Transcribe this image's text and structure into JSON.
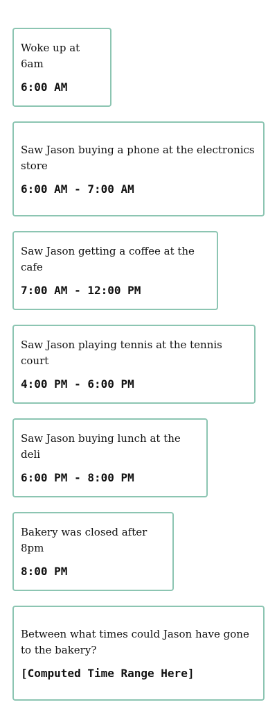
{
  "cards": [
    {
      "text": "Woke up at 6am",
      "time": "6:00 AM"
    },
    {
      "text": "Saw Jason buying a phone at the electronics store",
      "time": "6:00 AM - 7:00 AM"
    },
    {
      "text": "Saw Jason getting a coffee at the cafe",
      "time": "7:00 AM - 12:00 PM"
    },
    {
      "text": "Saw Jason playing tennis at the tennis court",
      "time": "4:00 PM - 6:00 PM"
    },
    {
      "text": "Saw Jason buying lunch at the deli",
      "time": "6:00 PM - 8:00 PM"
    },
    {
      "text": "Bakery was closed after 8pm",
      "time": "8:00 PM"
    },
    {
      "text": "Between what times could Jason have gone to the bakery?",
      "time": "[Computed Time Range Here]"
    }
  ],
  "colors": {
    "card_border": "#8cc5b2",
    "text": "#111111"
  }
}
